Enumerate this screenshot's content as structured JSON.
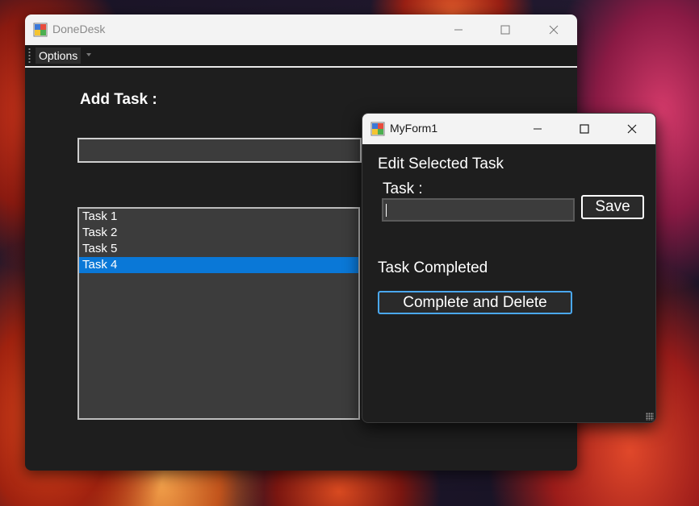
{
  "main_window": {
    "title": "DoneDesk",
    "icon": "winforms-app-icon",
    "controls": {
      "minimize": "minimize-icon",
      "maximize": "maximize-icon",
      "close": "close-icon"
    },
    "menu": {
      "options_label": "Options"
    },
    "add_task_label": "Add Task :",
    "add_task_input_value": "",
    "tasks": [
      {
        "label": "Task 1",
        "selected": false
      },
      {
        "label": "Task 2",
        "selected": false
      },
      {
        "label": "Task 5",
        "selected": false
      },
      {
        "label": "Task 4",
        "selected": true
      }
    ]
  },
  "dialog": {
    "title": "MyForm1",
    "icon": "winforms-app-icon",
    "heading": "Edit Selected Task",
    "task_label": "Task :",
    "task_input_value": "",
    "save_label": "Save",
    "completed_label": "Task Completed",
    "complete_delete_label": "Complete and Delete"
  },
  "colors": {
    "window_bg": "#1e1e1e",
    "titlebar_bg": "#f3f3f3",
    "input_bg": "#3c3c3c",
    "selection": "#0a78d7",
    "focus_border": "#4aa8f0"
  }
}
